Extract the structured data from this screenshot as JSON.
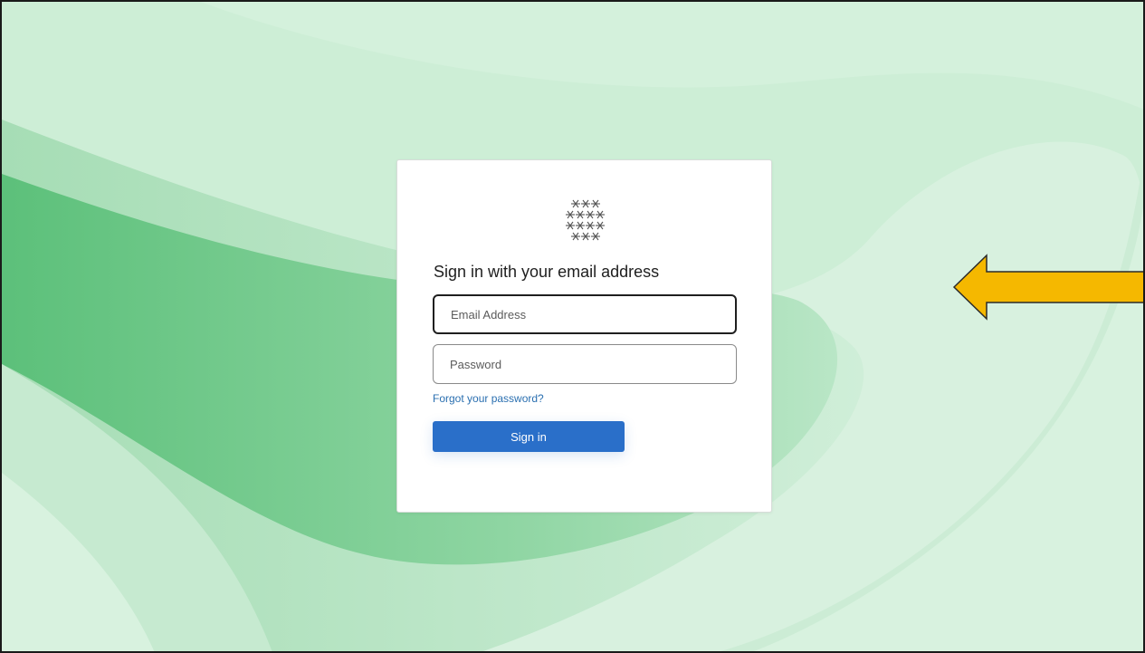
{
  "colors": {
    "background": "#d6f0de",
    "accent_button": "#2a6fc9",
    "link": "#2a6fb0",
    "arrow_fill": "#f5b800"
  },
  "login": {
    "logo_icon": "snowflake-cluster-icon",
    "heading": "Sign in with your email address",
    "email": {
      "placeholder": "Email Address",
      "value": ""
    },
    "password": {
      "placeholder": "Password",
      "value": ""
    },
    "forgot_password_label": "Forgot your password?",
    "sign_in_label": "Sign in"
  },
  "annotation": {
    "arrow_icon": "left-arrow-icon",
    "arrow_direction": "left"
  }
}
